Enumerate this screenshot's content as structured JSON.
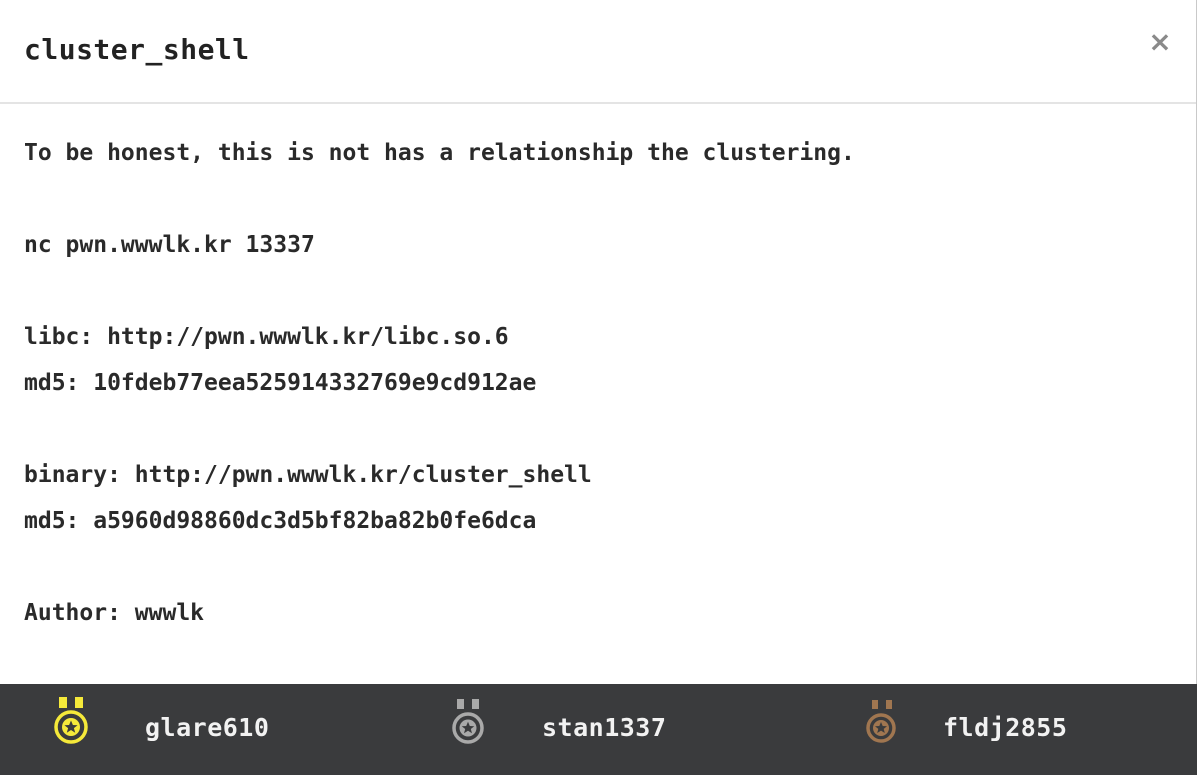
{
  "modal": {
    "title": "cluster_shell",
    "close_label": "×"
  },
  "description": {
    "lines": [
      "To be honest, this is not has a relationship the clustering.",
      "",
      "nc pwn.wwwlk.kr 13337",
      "",
      "libc: http://pwn.wwwlk.kr/libc.so.6",
      "md5: 10fdeb77eea525914332769e9cd912ae",
      "",
      "binary: http://pwn.wwwlk.kr/cluster_shell",
      "md5: a5960d98860dc3d5bf82ba82b0fe6dca",
      "",
      "Author: wwwlk"
    ]
  },
  "solvers": [
    {
      "rank": "gold",
      "icon": "gold-medal-icon",
      "color": "#f5e93a",
      "name": "glare610"
    },
    {
      "rank": "silver",
      "icon": "silver-medal-icon",
      "color": "#a9a9a9",
      "name": "stan1337"
    },
    {
      "rank": "bronze",
      "icon": "bronze-medal-icon",
      "color": "#a07650",
      "name": "fldj2855"
    }
  ],
  "colors": {
    "footer_bg": "#3a3b3d",
    "text": "#2a2a2a",
    "footer_text": "#f2f2f2"
  }
}
